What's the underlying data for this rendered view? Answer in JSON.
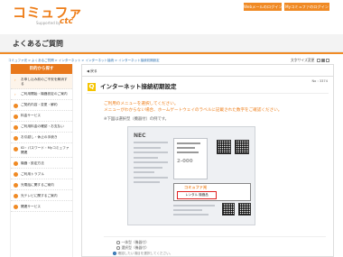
{
  "header": {
    "logo_text": "コミュファ",
    "logo_sub": "Supported by",
    "logo_brand": "ctc",
    "button_web": "Webメールのログイン",
    "button_my": "Myコミュファのログイン"
  },
  "page": {
    "title": "よくあるご質問"
  },
  "breadcrumb": "コミュファ光 > よくあるご質問 > インターネット > インターネット接続 > インターネット接続初期設定",
  "font_size": {
    "label": "文字サイズ変更",
    "options": [
      "小",
      "中",
      "大"
    ]
  },
  "sidebar": {
    "heading": "目的から探す",
    "items": [
      {
        "label": "お申し込み前のご不安を解消する",
        "marker": "arrow"
      },
      {
        "label": "ご利用開始・機器設定のご案内",
        "marker": "arrow"
      },
      {
        "label": "ご契約内容・変更・解約",
        "marker": "dot"
      },
      {
        "label": "料金サービス",
        "marker": "dot"
      },
      {
        "label": "ご利用料金の確認・お支払い",
        "marker": "dot"
      },
      {
        "label": "お引越し・休止の手続き",
        "marker": "dot"
      },
      {
        "label": "ID・パスワード・Myコミュファ関連",
        "marker": "dot"
      },
      {
        "label": "機器・設定方法",
        "marker": "dot"
      },
      {
        "label": "ご利用トラブル",
        "marker": "dot"
      },
      {
        "label": "光電話に関するご案内",
        "marker": "dot"
      },
      {
        "label": "光テレビに関するご案内",
        "marker": "dot"
      },
      {
        "label": "関連サービス",
        "marker": "dot"
      }
    ]
  },
  "main": {
    "back_label": "戻る",
    "question_no": "No : 3374",
    "q_badge": "Q",
    "question_title": "インターネット接続初期設定",
    "instruction_1": "ご利用のメニューを選択してください。",
    "instruction_2": "メニューがわからない場合、ホームゲートウェイのラベルに記載された数字をご確認ください。",
    "note": "※下図は選択型（機器付）の例です。",
    "sheet": {
      "brand_top": "NEC",
      "label_brand": "コミュファ光",
      "label_text": "レンタル 機器品",
      "code_text": "2-000"
    },
    "options": [
      "一体型（機器付）",
      "選択型（機器付）"
    ],
    "hint": "確認したい項目を選択してください。"
  }
}
